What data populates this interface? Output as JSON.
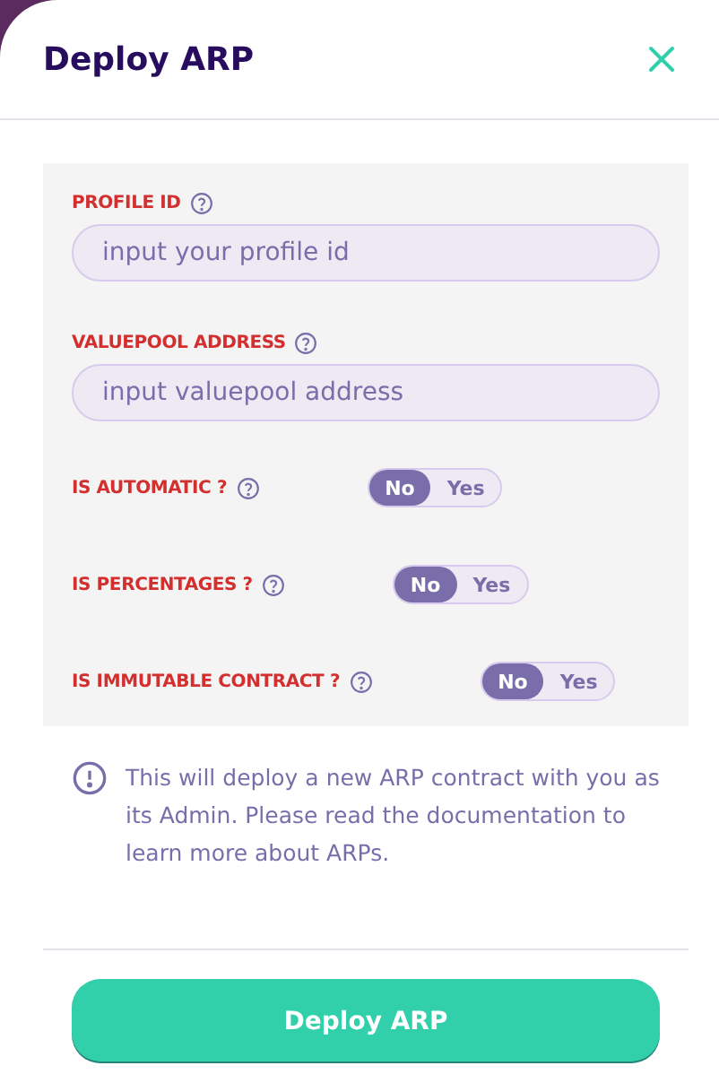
{
  "modal": {
    "title": "Deploy ARP"
  },
  "fields": [
    {
      "label": "PROFILE ID",
      "placeholder": "input your profile id"
    },
    {
      "label": "VALUEPOOL ADDRESS",
      "placeholder": "input valuepool address"
    }
  ],
  "toggles": [
    {
      "label": "IS AUTOMATIC ?",
      "options": [
        {
          "label": "No",
          "selected": true
        },
        {
          "label": "Yes",
          "selected": false
        }
      ]
    },
    {
      "label": "IS PERCENTAGES ?",
      "options": [
        {
          "label": "No",
          "selected": true
        },
        {
          "label": "Yes",
          "selected": false
        }
      ]
    },
    {
      "label": "IS IMMUTABLE CONTRACT ?",
      "options": [
        {
          "label": "No",
          "selected": true
        },
        {
          "label": "Yes",
          "selected": false
        }
      ]
    }
  ],
  "notice": "This will deploy a new ARP contract with you as its Admin. Please read the documentation to learn more about ARPs.",
  "submit": "Deploy ARP"
}
